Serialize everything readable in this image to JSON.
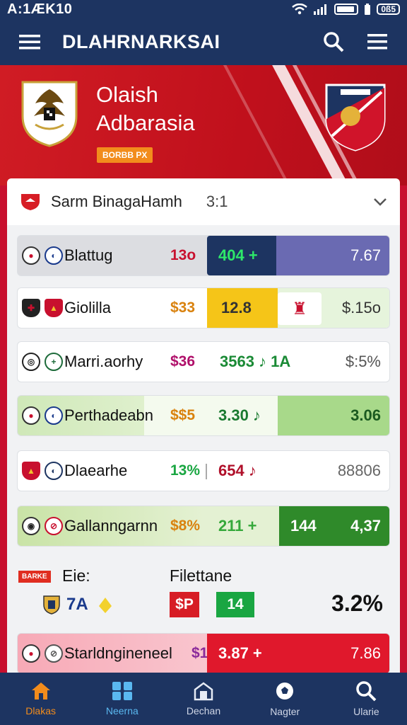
{
  "status": {
    "time": "A:1ÆK10",
    "battery": "0ß5"
  },
  "appbar": {
    "title": "DLAHRNARKSAI"
  },
  "hero": {
    "team_line1": "Olaish",
    "team_line2": "Adbarasia",
    "badge": "BORBB PX"
  },
  "card": {
    "league": "Sarm BinagaHamh",
    "score": "3:1"
  },
  "rows": [
    {
      "name": "Blattug",
      "pct": "13o",
      "mid": "404 +",
      "right": "7.67"
    },
    {
      "name": "Giolilla",
      "pct": "$33",
      "mid": "12.8",
      "right": "$.15o"
    },
    {
      "name": "Marri.aorhy",
      "pct": "$36",
      "mid": "3563 ♪ 1A",
      "right": "$:5%"
    },
    {
      "name": "Perthadeabn",
      "pct": "$$5",
      "mid": "3.30 ♪",
      "right": "3.06"
    },
    {
      "name": "Dlaearhe",
      "pct": "13%",
      "mid": "654 ♪",
      "right": "88806"
    },
    {
      "name": "Gallanngarnn",
      "pct": "$8%",
      "mid": "211 +",
      "mid2": "144",
      "right": "4,37"
    },
    {
      "name": "Starldngineneel",
      "pct": "$1",
      "mid": "3.87 +",
      "right": "7.86"
    }
  ],
  "special": {
    "tag": "BARKE",
    "label1": "Eie:",
    "label2": "Filettane",
    "value1": "7A",
    "box1": "$P",
    "box2": "14",
    "big": "3.2%"
  },
  "nav": [
    {
      "label": "Dlakas",
      "icon": "home-icon"
    },
    {
      "label": "Neerna",
      "icon": "grid-icon"
    },
    {
      "label": "Dechan",
      "icon": "stadium-icon"
    },
    {
      "label": "Nagter",
      "icon": "ball-icon"
    },
    {
      "label": "Ularie",
      "icon": "search-icon"
    }
  ],
  "colors": {
    "navy": "#1d3461",
    "red": "#c8102e",
    "orange": "#f28c1c",
    "green": "#1aa642"
  }
}
